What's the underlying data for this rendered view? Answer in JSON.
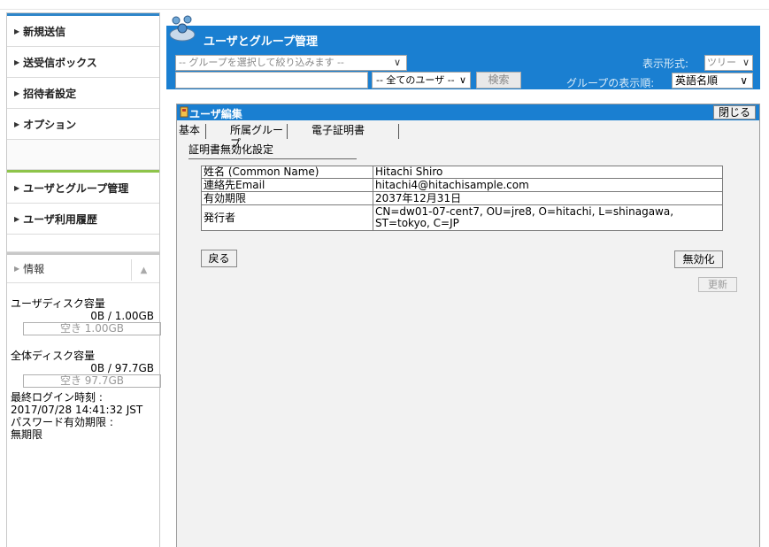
{
  "sidebar": {
    "nav_top": [
      {
        "label": "新規送信"
      },
      {
        "label": "送受信ボックス"
      },
      {
        "label": "招待者設定"
      },
      {
        "label": "オプション"
      }
    ],
    "nav_admin": [
      {
        "label": "ユーザとグループ管理"
      },
      {
        "label": "ユーザ利用履歴"
      }
    ],
    "info": {
      "header": "情報",
      "user_disk_title": "ユーザディスク容量",
      "user_disk_usage": "0B / 1.00GB",
      "user_disk_free": "空き 1.00GB",
      "total_disk_title": "全体ディスク容量",
      "total_disk_usage": "0B / 97.7GB",
      "total_disk_free": "空き 97.7GB",
      "last_login_label": "最終ログイン時刻 :",
      "last_login_value": "2017/07/28 14:41:32 JST",
      "pw_expiry_label": "パスワード有効期限 :",
      "pw_expiry_value": "無期限"
    }
  },
  "header": {
    "title": "ユーザとグループ管理",
    "group_filter_placeholder": "-- グループを選択して絞り込みます --",
    "name_input_value": "",
    "user_select_value": "-- 全てのユーザ --",
    "search_label": "検索",
    "view_mode_label": "表示形式:",
    "view_mode_value": "ツリー",
    "group_order_label": "グループの表示順:",
    "group_order_value": "英語名順"
  },
  "panel": {
    "title": "ユーザ編集",
    "close_label": "閉じる",
    "tabs": [
      {
        "label": "基本"
      },
      {
        "label": "所属グループ"
      },
      {
        "label": "電子証明書"
      }
    ],
    "subtitle": "証明書無効化設定",
    "rows": [
      {
        "key": "姓名 (Common Name)",
        "value": "Hitachi Shiro"
      },
      {
        "key": "連絡先Email",
        "value": "hitachi4@hitachisample.com"
      },
      {
        "key": "有効期限",
        "value": "2037年12月31日"
      },
      {
        "key": "発行者",
        "value": "CN=dw01-07-cent7, OU=jre8, O=hitachi, L=shinagawa, ST=tokyo, C=JP"
      }
    ],
    "back_label": "戻る",
    "revoke_label": "無効化",
    "update_label": "更新"
  },
  "colors": {
    "brand_blue": "#1a7fd1",
    "nav_accent_blue": "#2f86c9",
    "nav_accent_green": "#8ec44a"
  }
}
